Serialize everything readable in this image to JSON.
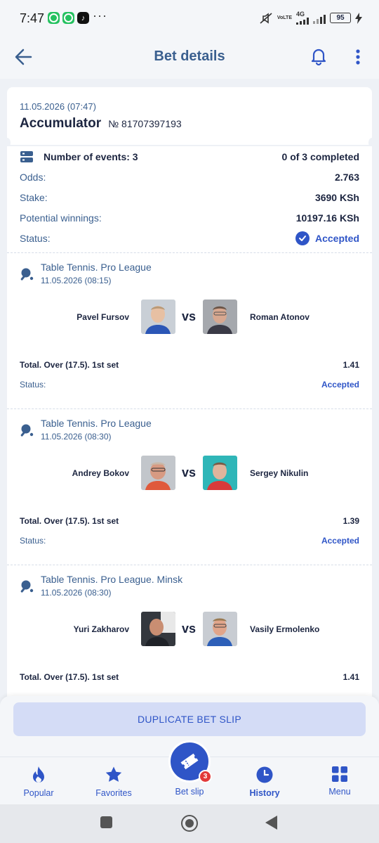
{
  "status_bar": {
    "time": "7:47",
    "battery": "95",
    "network": "4G",
    "network_sub": "VoLTE",
    "more": "···"
  },
  "header": {
    "title": "Bet details"
  },
  "bet": {
    "datetime": "11.05.2026 (07:47)",
    "type": "Accumulator",
    "number": "№ 81707397193",
    "events_label": "Number of events: 3",
    "completed": "0 of 3 completed",
    "odds_label": "Odds:",
    "odds_value": "2.763",
    "stake_label": "Stake:",
    "stake_value": "3690 KSh",
    "winnings_label": "Potential winnings:",
    "winnings_value": "10197.16 KSh",
    "status_label": "Status:",
    "status_value": "Accepted"
  },
  "events": [
    {
      "league": "Table Tennis. Pro League",
      "datetime": "11.05.2026 (08:15)",
      "team1": "Pavel Fursov",
      "team2": "Roman Atonov",
      "vs": "vs",
      "bet": "Total. Over (17.5). 1st set",
      "odds": "1.41",
      "status_label": "Status:",
      "status": "Accepted"
    },
    {
      "league": "Table Tennis. Pro League",
      "datetime": "11.05.2026 (08:30)",
      "team1": "Andrey Bokov",
      "team2": "Sergey Nikulin",
      "vs": "vs",
      "bet": "Total. Over (17.5). 1st set",
      "odds": "1.39",
      "status_label": "Status:",
      "status": "Accepted"
    },
    {
      "league": "Table Tennis. Pro League. Minsk",
      "datetime": "11.05.2026 (08:30)",
      "team1": "Yuri Zakharov",
      "team2": "Vasily Ermolenko",
      "vs": "vs",
      "bet": "Total. Over (17.5). 1st set",
      "odds": "1.41"
    }
  ],
  "actions": {
    "duplicate": "DUPLICATE BET SLIP"
  },
  "tabs": {
    "popular": "Popular",
    "favorites": "Favorites",
    "betslip": "Bet slip",
    "betslip_count": "3",
    "history": "History",
    "menu": "Menu"
  },
  "colors": {
    "accent": "#2f55c7",
    "label": "#3a5f8f",
    "text": "#1c2540",
    "badge": "#e23a3a"
  }
}
